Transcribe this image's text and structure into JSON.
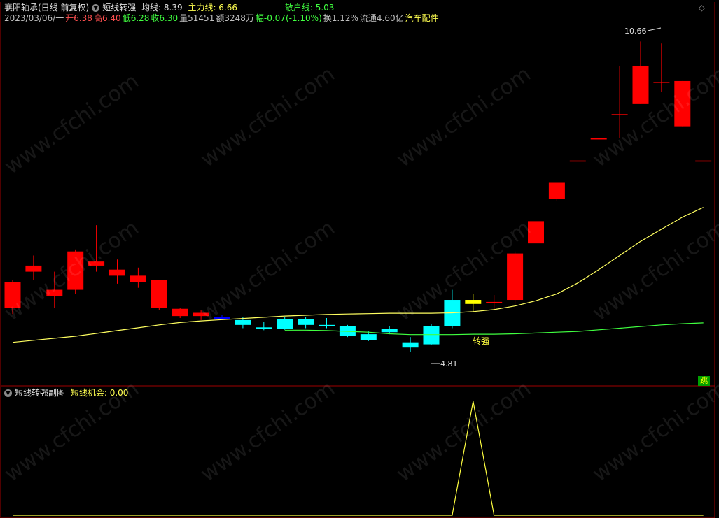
{
  "header": {
    "stock_name": "襄阳轴承(日线 前复权)",
    "indicator_name": "短线转强",
    "avg_line": "均线: 8.39",
    "main_line": "主力线: 6.66",
    "retail_line": "散户线: 5.03",
    "date": "2023/03/06/一",
    "open": "开6.38",
    "high": "高6.40",
    "low": "低6.28",
    "close": "收6.30",
    "volume": "量51451",
    "amount": "额3248万",
    "change": "幅-0.07(-1.10%)",
    "turnover": "换1.12%",
    "float_cap": "流通4.60亿",
    "sector": "汽车配件"
  },
  "subchart": {
    "name": "短线转强副图",
    "value_label": "短线机会: 0.00"
  },
  "annotations": {
    "high_label": "10.66",
    "low_label": "4.81",
    "signal_label": "转强",
    "jump_button": "跳"
  },
  "watermark": "www.cfchi.com",
  "colors": {
    "up": "#ff0000",
    "down": "#00ffff",
    "dark_down": "#0000ff",
    "neutral": "#ffff00",
    "avg_line": "#ffff60",
    "main_line": "#40ff40",
    "grid": "#a00000"
  },
  "chart_data": {
    "type": "candlestick",
    "dates_shown": [
      "2023/03/06/一"
    ],
    "candles": [
      {
        "o": 5.9,
        "h": 6.6,
        "l": 5.75,
        "c": 6.55,
        "color": "up"
      },
      {
        "o": 6.8,
        "h": 7.2,
        "l": 6.6,
        "c": 6.95,
        "color": "up"
      },
      {
        "o": 6.2,
        "h": 6.8,
        "l": 5.9,
        "c": 6.35,
        "color": "up"
      },
      {
        "o": 6.35,
        "h": 7.35,
        "l": 6.25,
        "c": 7.3,
        "color": "up"
      },
      {
        "o": 6.95,
        "h": 7.95,
        "l": 6.8,
        "c": 7.05,
        "color": "up"
      },
      {
        "o": 6.7,
        "h": 7.1,
        "l": 6.5,
        "c": 6.85,
        "color": "up"
      },
      {
        "o": 6.55,
        "h": 6.9,
        "l": 6.4,
        "c": 6.7,
        "color": "up"
      },
      {
        "o": 5.9,
        "h": 6.6,
        "l": 5.85,
        "c": 6.6,
        "color": "up"
      },
      {
        "o": 5.7,
        "h": 5.9,
        "l": 5.65,
        "c": 5.88,
        "color": "up"
      },
      {
        "o": 5.7,
        "h": 5.85,
        "l": 5.6,
        "c": 5.78,
        "color": "up"
      },
      {
        "o": 5.68,
        "h": 5.72,
        "l": 5.6,
        "c": 5.62,
        "color": "dark_down"
      },
      {
        "o": 5.6,
        "h": 5.68,
        "l": 5.4,
        "c": 5.48,
        "color": "down"
      },
      {
        "o": 5.42,
        "h": 5.55,
        "l": 5.35,
        "c": 5.38,
        "color": "down"
      },
      {
        "o": 5.62,
        "h": 5.68,
        "l": 5.36,
        "c": 5.38,
        "color": "down"
      },
      {
        "o": 5.62,
        "h": 5.68,
        "l": 5.4,
        "c": 5.48,
        "color": "down"
      },
      {
        "o": 5.48,
        "h": 5.65,
        "l": 5.4,
        "c": 5.45,
        "color": "down"
      },
      {
        "o": 5.45,
        "h": 5.48,
        "l": 5.18,
        "c": 5.2,
        "color": "down"
      },
      {
        "o": 5.25,
        "h": 5.32,
        "l": 5.08,
        "c": 5.1,
        "color": "down"
      },
      {
        "o": 5.38,
        "h": 5.45,
        "l": 5.25,
        "c": 5.3,
        "color": "down"
      },
      {
        "o": 5.05,
        "h": 5.18,
        "l": 4.81,
        "c": 4.92,
        "color": "down"
      },
      {
        "o": 5.45,
        "h": 5.5,
        "l": 4.98,
        "c": 5.0,
        "color": "down"
      },
      {
        "o": 6.1,
        "h": 6.35,
        "l": 5.4,
        "c": 5.45,
        "color": "down"
      },
      {
        "o": 6.0,
        "h": 6.25,
        "l": 5.8,
        "c": 6.1,
        "color": "neutral"
      },
      {
        "o": 6.05,
        "h": 6.22,
        "l": 5.85,
        "c": 6.05,
        "color": "up"
      },
      {
        "o": 6.1,
        "h": 7.3,
        "l": 6.0,
        "c": 7.25,
        "color": "up"
      },
      {
        "o": 7.5,
        "h": 8.05,
        "l": 7.5,
        "c": 8.05,
        "color": "up"
      },
      {
        "o": 8.6,
        "h": 9.0,
        "l": 8.55,
        "c": 9.0,
        "color": "up"
      },
      {
        "o": 9.55,
        "h": 9.55,
        "l": 9.55,
        "c": 9.55,
        "color": "up"
      },
      {
        "o": 10.1,
        "h": 10.1,
        "l": 10.1,
        "c": 10.1,
        "color": "up"
      },
      {
        "o": 10.7,
        "h": 11.9,
        "l": 10.1,
        "c": 10.7,
        "color": "up"
      },
      {
        "o": 11.9,
        "h": 12.5,
        "l": 10.95,
        "c": 10.95,
        "color": "up"
      },
      {
        "o": 11.5,
        "h": 12.45,
        "l": 11.25,
        "c": 11.5,
        "color": "up"
      },
      {
        "o": 10.4,
        "h": 11.52,
        "l": 10.4,
        "c": 11.52,
        "color": "up"
      },
      {
        "o": 9.55,
        "h": 9.55,
        "l": 9.55,
        "c": 9.55,
        "color": "up"
      }
    ],
    "avg_line": [
      5.05,
      5.1,
      5.15,
      5.2,
      5.27,
      5.34,
      5.41,
      5.48,
      5.54,
      5.58,
      5.61,
      5.64,
      5.67,
      5.7,
      5.72,
      5.74,
      5.75,
      5.76,
      5.77,
      5.77,
      5.77,
      5.78,
      5.81,
      5.86,
      5.95,
      6.08,
      6.25,
      6.52,
      6.85,
      7.2,
      7.55,
      7.85,
      8.15,
      8.39
    ],
    "main_line": [
      null,
      null,
      null,
      null,
      null,
      null,
      null,
      null,
      null,
      null,
      null,
      null,
      null,
      5.35,
      5.35,
      5.34,
      5.32,
      5.3,
      5.26,
      5.24,
      5.24,
      5.24,
      5.25,
      5.25,
      5.26,
      5.28,
      5.3,
      5.32,
      5.36,
      5.4,
      5.44,
      5.48,
      5.51,
      5.53
    ],
    "subchart_signal": [
      0,
      0,
      0,
      0,
      0,
      0,
      0,
      0,
      0,
      0,
      0,
      0,
      0,
      0,
      0,
      0,
      0,
      0,
      0,
      0,
      0,
      0,
      1,
      0,
      0,
      0,
      0,
      0,
      0,
      0,
      0,
      0,
      0,
      0
    ],
    "ylim": [
      4.3,
      12.8
    ]
  }
}
